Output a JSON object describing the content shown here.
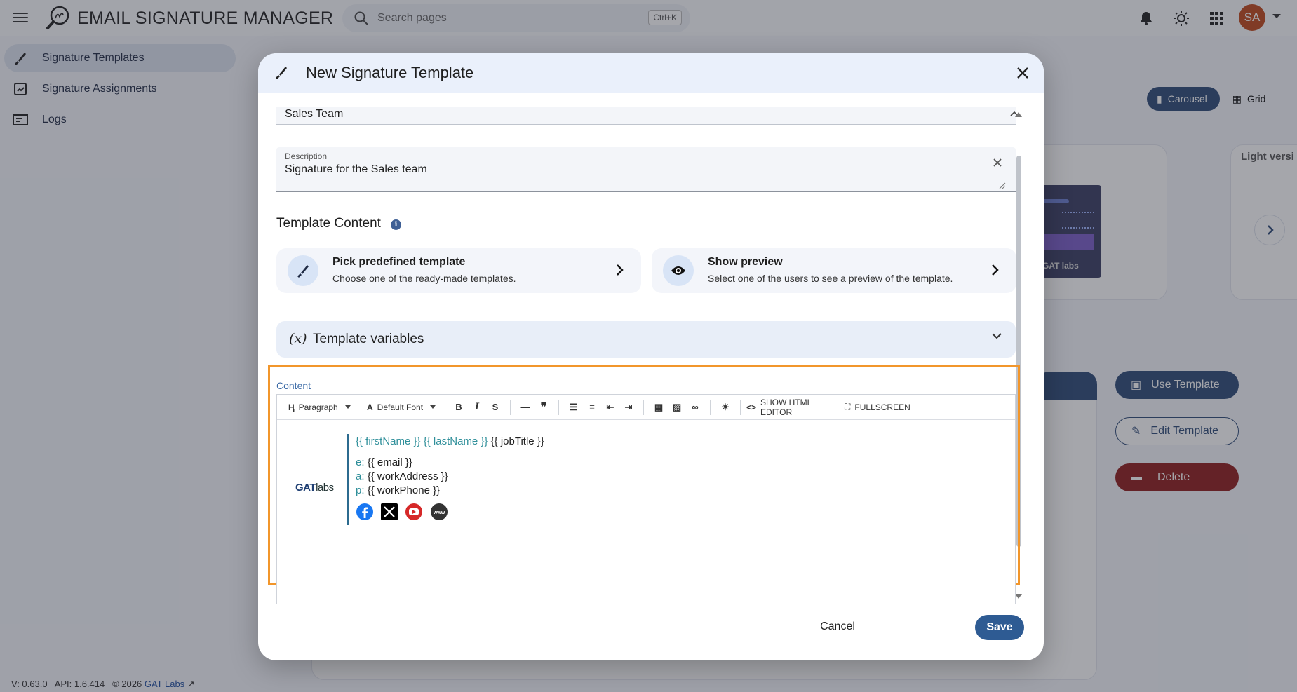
{
  "app": {
    "title": "EMAIL SIGNATURE MANAGER",
    "search_placeholder": "Search pages",
    "search_shortcut": "Ctrl+K",
    "avatar_initials": "SA",
    "accent": "#2e4a77"
  },
  "sidebar": {
    "items": [
      {
        "label": "Signature Templates",
        "icon": "brush-icon",
        "active": true
      },
      {
        "label": "Signature Assignments",
        "icon": "assignment-icon",
        "active": false
      },
      {
        "label": "Logs",
        "icon": "logs-icon",
        "active": false
      }
    ]
  },
  "footer": {
    "version": "V: 0.63.0",
    "api": "API: 1.6.414",
    "copyright": "© 2026",
    "link": "GAT Labs"
  },
  "background": {
    "view_carousel": "Carousel",
    "view_grid": "Grid",
    "light_version_label": "Light versi",
    "thumb_logo": "GAT labs",
    "use_template": "Use Template",
    "edit_template": "Edit Template",
    "delete": "Delete"
  },
  "dialog": {
    "title": "New Signature Template",
    "name_value": "Sales Team",
    "description_label": "Description",
    "description_value": "Signature for the Sales team",
    "template_content_title": "Template Content",
    "pick_card": {
      "title": "Pick predefined template",
      "subtitle": "Choose one of the ready-made templates."
    },
    "preview_card": {
      "title": "Show preview",
      "subtitle": "Select one of the users to see a preview of the template."
    },
    "variables": {
      "symbol": "(x)",
      "label": "Template variables"
    },
    "content_label": "Content",
    "toolbar": {
      "paragraph": "Paragraph",
      "font": "Default Font",
      "html_editor": "SHOW HTML EDITOR",
      "fullscreen": "FULLSCREEN"
    },
    "signature": {
      "logo_bold": "GAT",
      "logo_light": "labs",
      "first_name": "{{ firstName }}",
      "last_name": "{{ lastName }}",
      "job_title": "{{ jobTitle }}",
      "email_prefix": "e:",
      "email": "{{ email }}",
      "address_prefix": "a:",
      "address": "{{ workAddress }}",
      "phone_prefix": "p:",
      "phone": "{{ workPhone }}",
      "social_icons": [
        "facebook-icon",
        "x-icon",
        "youtube-icon",
        "www-icon"
      ],
      "www_label": "www"
    },
    "cancel": "Cancel",
    "save": "Save"
  }
}
